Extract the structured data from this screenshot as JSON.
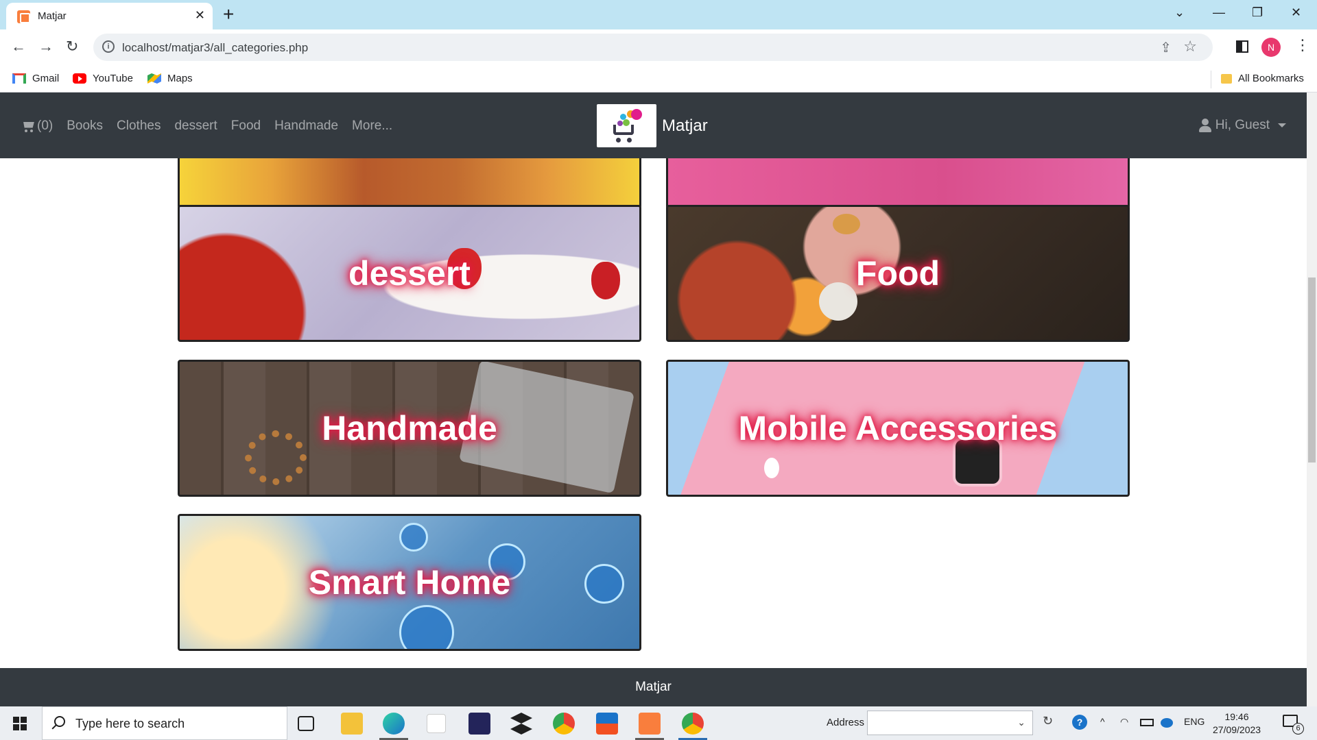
{
  "browser": {
    "tab_title": "Matjar",
    "url": "localhost/matjar3/all_categories.php",
    "profile_initial": "N",
    "bookmarks": [
      {
        "label": "Gmail",
        "icon": "gmail-icon"
      },
      {
        "label": "YouTube",
        "icon": "youtube-icon"
      },
      {
        "label": "Maps",
        "icon": "maps-icon"
      }
    ],
    "all_bookmarks_label": "All Bookmarks"
  },
  "site": {
    "cart_count": "(0)",
    "nav_items": [
      "Books",
      "Clothes",
      "dessert",
      "Food",
      "Handmade",
      "More..."
    ],
    "brand_name": "Matjar",
    "user_greeting": "Hi, Guest",
    "categories": [
      {
        "name": "",
        "image": "books-image"
      },
      {
        "name": "",
        "image": "clothes-image"
      },
      {
        "name": "dessert",
        "image": "dessert-image"
      },
      {
        "name": "Food",
        "image": "food-image"
      },
      {
        "name": "Handmade",
        "image": "handmade-image"
      },
      {
        "name": "Mobile Accessories",
        "image": "mobile-accessories-image"
      },
      {
        "name": "Smart Home",
        "image": "smart-home-image"
      }
    ],
    "footer_text": "Matjar",
    "colors": {
      "navbar": "#343a40",
      "label_glow": "#e11d48"
    }
  },
  "taskbar": {
    "search_placeholder": "Type here to search",
    "address_label": "Address",
    "language": "ENG",
    "time": "19:46",
    "date": "27/09/2023",
    "notification_count": "6"
  }
}
